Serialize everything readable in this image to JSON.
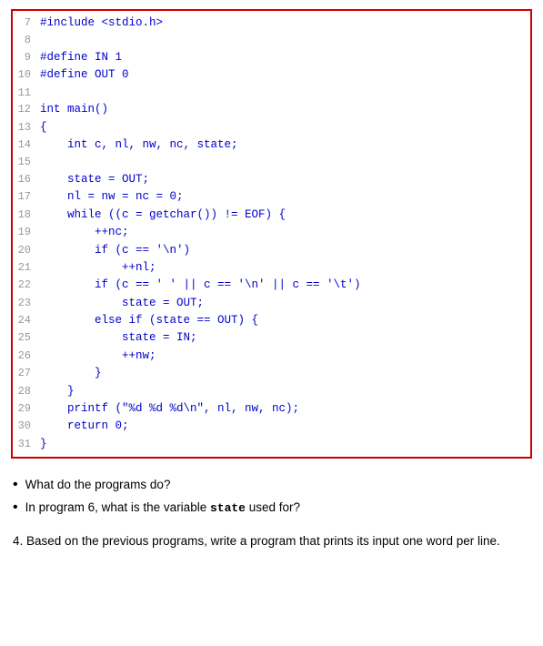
{
  "code": {
    "border_color": "#cc0000",
    "lines": [
      {
        "num": "7",
        "content": "#include <stdio.h>"
      },
      {
        "num": "8",
        "content": ""
      },
      {
        "num": "9",
        "content": "#define IN 1"
      },
      {
        "num": "10",
        "content": "#define OUT 0"
      },
      {
        "num": "11",
        "content": ""
      },
      {
        "num": "12",
        "content": "int main()"
      },
      {
        "num": "13",
        "content": "{"
      },
      {
        "num": "14",
        "content": "    int c, nl, nw, nc, state;"
      },
      {
        "num": "15",
        "content": ""
      },
      {
        "num": "16",
        "content": "    state = OUT;"
      },
      {
        "num": "17",
        "content": "    nl = nw = nc = 0;"
      },
      {
        "num": "18",
        "content": "    while ((c = getchar()) != EOF) {"
      },
      {
        "num": "19",
        "content": "        ++nc;"
      },
      {
        "num": "20",
        "content": "        if (c == '\\n')"
      },
      {
        "num": "21",
        "content": "            ++nl;"
      },
      {
        "num": "22",
        "content": "        if (c == ' ' || c == '\\n' || c == '\\t')"
      },
      {
        "num": "23",
        "content": "            state = OUT;"
      },
      {
        "num": "24",
        "content": "        else if (state == OUT) {"
      },
      {
        "num": "25",
        "content": "            state = IN;"
      },
      {
        "num": "26",
        "content": "            ++nw;"
      },
      {
        "num": "27",
        "content": "        }"
      },
      {
        "num": "28",
        "content": "    }"
      },
      {
        "num": "29",
        "content": "    printf (\"%d %d %d\\n\", nl, nw, nc);"
      },
      {
        "num": "30",
        "content": "    return 0;"
      },
      {
        "num": "31",
        "content": "}"
      }
    ]
  },
  "questions": {
    "bullet_items": [
      {
        "text": "What do the programs do?"
      },
      {
        "text": "In program 6, what is the variable ",
        "code": "state",
        "text_after": " used for?"
      }
    ],
    "numbered": {
      "number": "4.",
      "text": "Based on the previous programs, write a program that prints its input one word per line."
    }
  }
}
